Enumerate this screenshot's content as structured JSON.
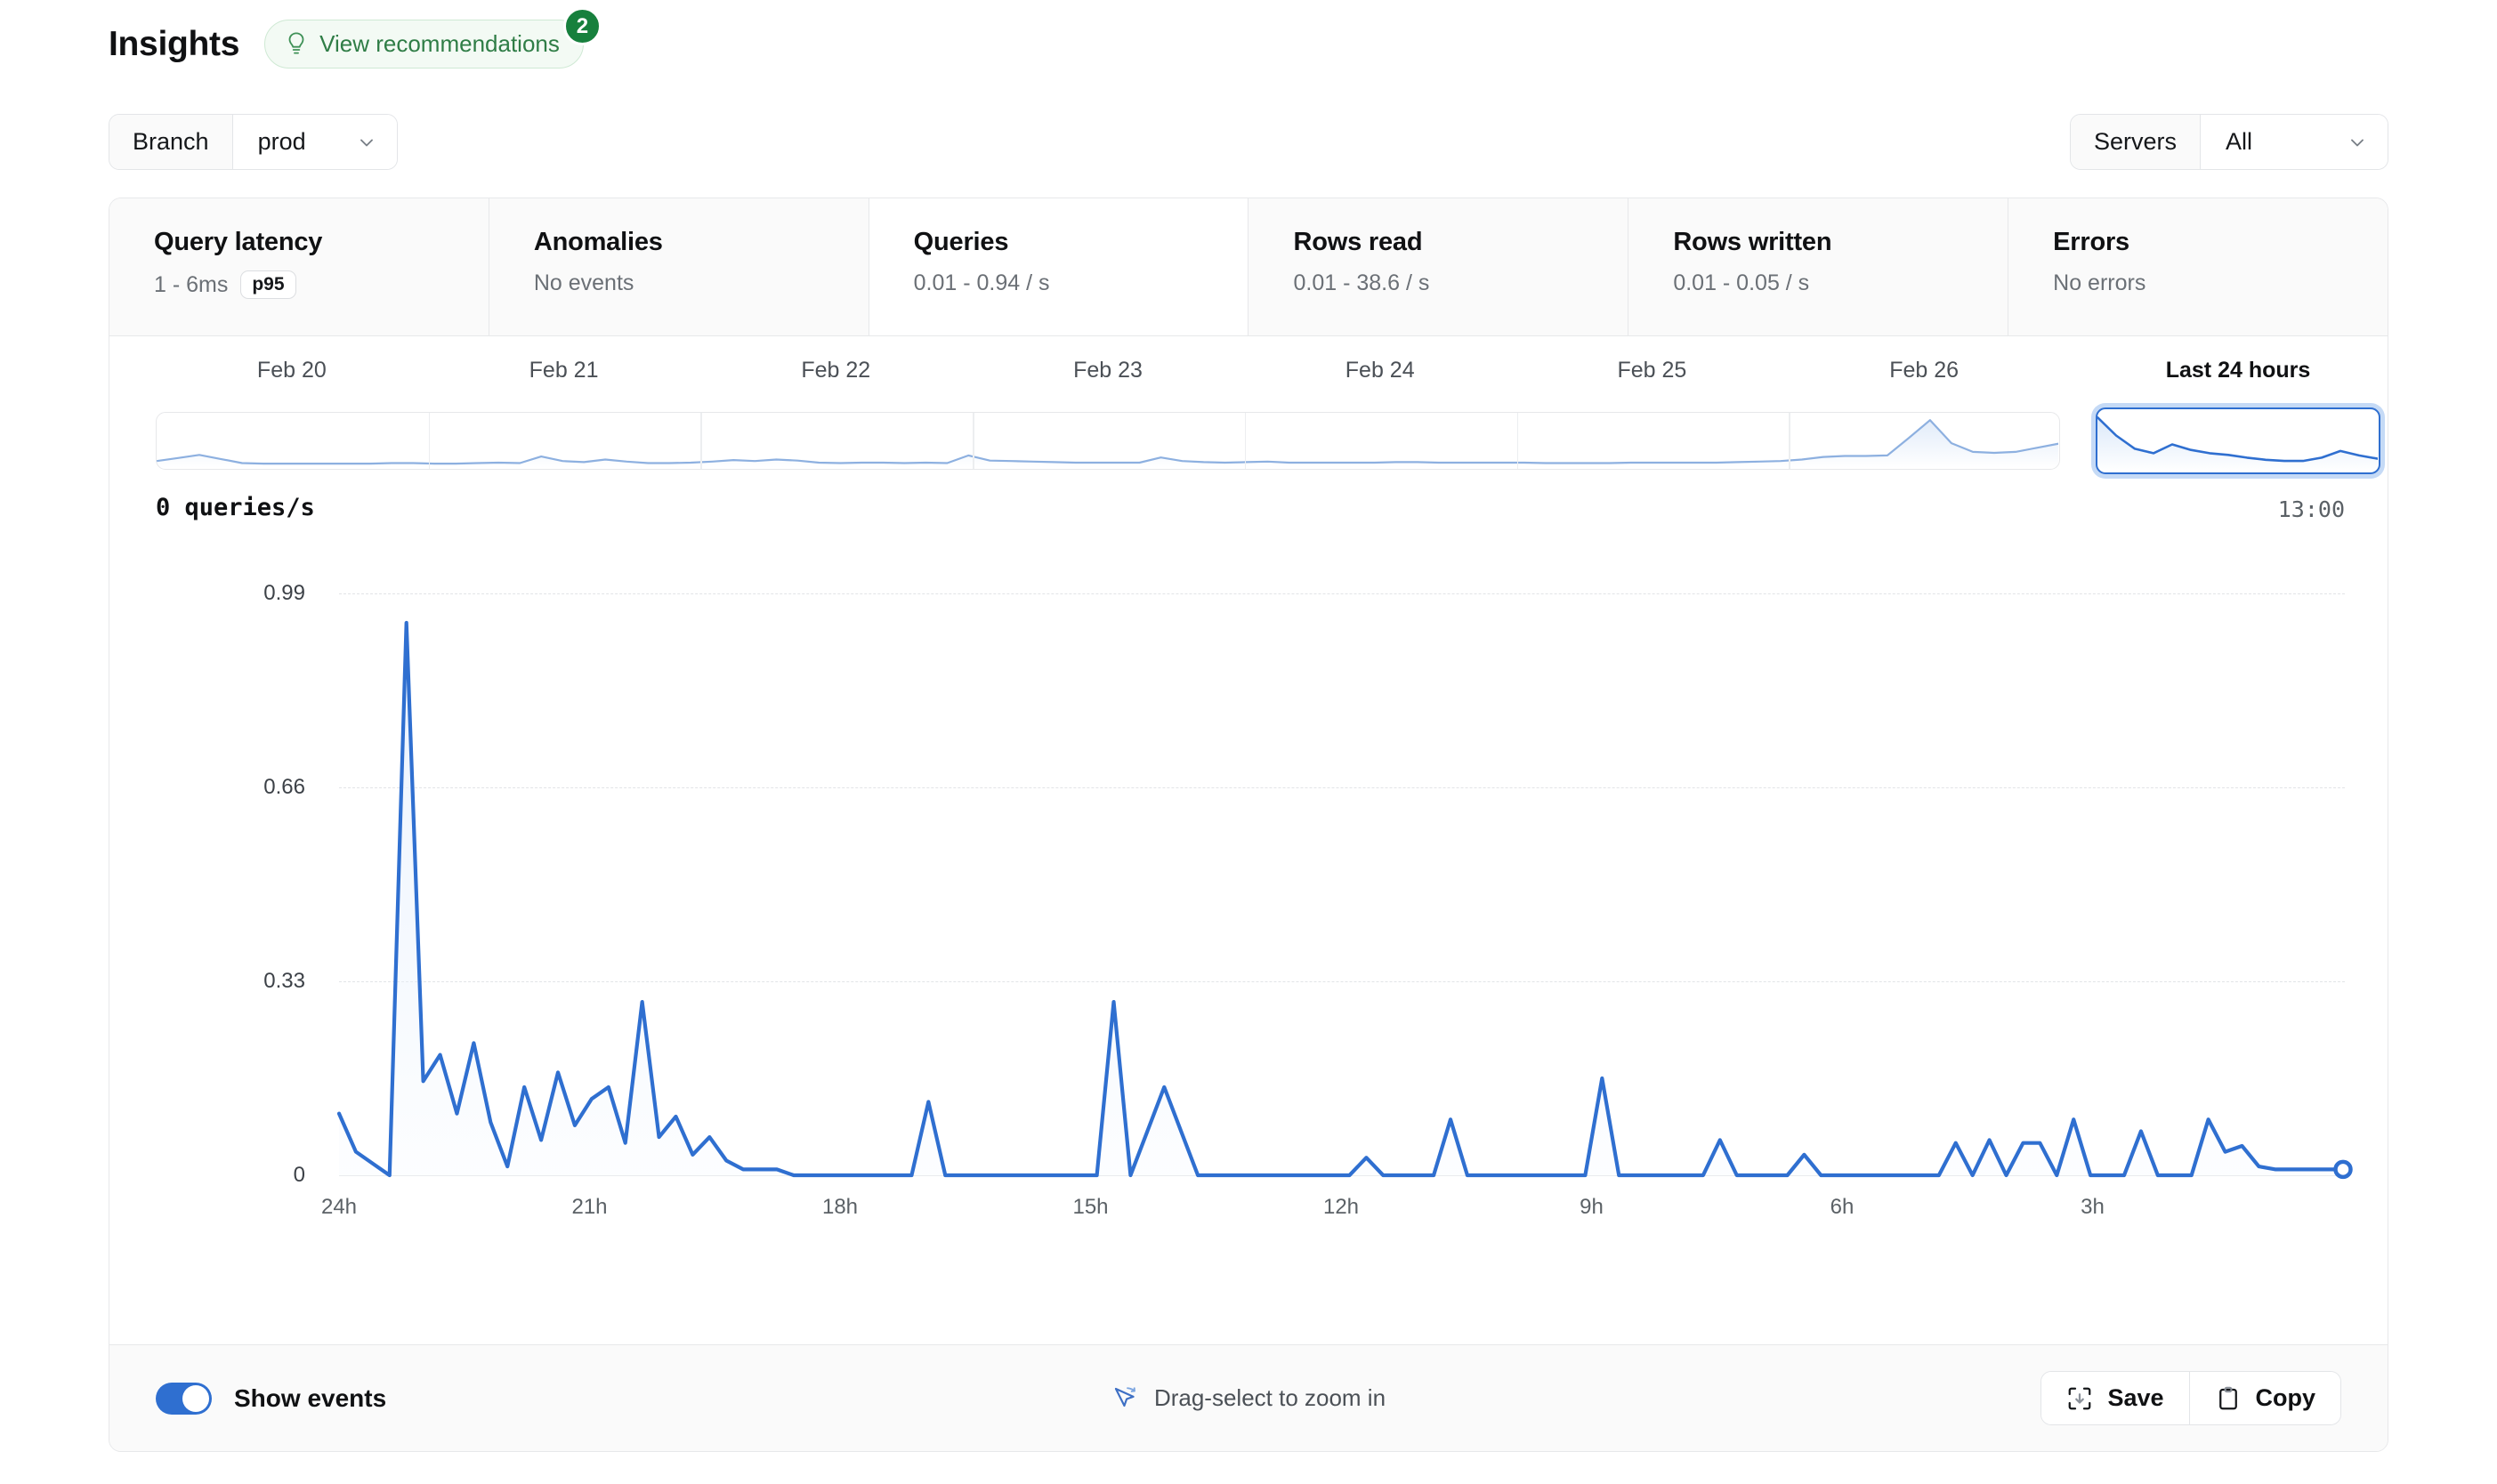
{
  "header": {
    "title": "Insights",
    "recommendations_label": "View recommendations",
    "recommendations_badge": "2",
    "bulb_icon": "lightbulb-icon"
  },
  "filters": {
    "branch": {
      "label": "Branch",
      "value": "prod"
    },
    "servers": {
      "label": "Servers",
      "value": "All"
    }
  },
  "metrics": [
    {
      "title": "Query latency",
      "sub": "1 - 6ms",
      "pill": "p95",
      "active": false
    },
    {
      "title": "Anomalies",
      "sub": "No events",
      "pill": "",
      "active": false
    },
    {
      "title": "Queries",
      "sub": "0.01 - 0.94 / s",
      "pill": "",
      "active": true
    },
    {
      "title": "Rows read",
      "sub": "0.01 - 38.6 / s",
      "pill": "",
      "active": false
    },
    {
      "title": "Rows written",
      "sub": "0.01 - 0.05 / s",
      "pill": "",
      "active": false
    },
    {
      "title": "Errors",
      "sub": "No errors",
      "pill": "",
      "active": false
    }
  ],
  "timeline": {
    "segments": [
      {
        "label": "Feb 20",
        "selected": false
      },
      {
        "label": "Feb 21",
        "selected": false
      },
      {
        "label": "Feb 22",
        "selected": false
      },
      {
        "label": "Feb 23",
        "selected": false
      },
      {
        "label": "Feb 24",
        "selected": false
      },
      {
        "label": "Feb 25",
        "selected": false
      },
      {
        "label": "Feb 26",
        "selected": false
      }
    ],
    "selection": {
      "label": "Last 24 hours",
      "selected": true
    },
    "spark_values": [
      0.1,
      0.16,
      0.22,
      0.14,
      0.06,
      0.05,
      0.05,
      0.05,
      0.05,
      0.05,
      0.05,
      0.06,
      0.06,
      0.05,
      0.05,
      0.06,
      0.07,
      0.06,
      0.19,
      0.1,
      0.08,
      0.13,
      0.09,
      0.06,
      0.06,
      0.07,
      0.09,
      0.12,
      0.1,
      0.13,
      0.11,
      0.07,
      0.06,
      0.07,
      0.07,
      0.06,
      0.07,
      0.06,
      0.21,
      0.11,
      0.1,
      0.09,
      0.08,
      0.07,
      0.07,
      0.07,
      0.07,
      0.17,
      0.1,
      0.08,
      0.07,
      0.08,
      0.09,
      0.07,
      0.07,
      0.07,
      0.07,
      0.07,
      0.08,
      0.08,
      0.07,
      0.07,
      0.07,
      0.07,
      0.07,
      0.06,
      0.06,
      0.06,
      0.06,
      0.07,
      0.07,
      0.07,
      0.07,
      0.07,
      0.08,
      0.09,
      0.1,
      0.13,
      0.18,
      0.2,
      0.2,
      0.21,
      0.55,
      0.9,
      0.45,
      0.28,
      0.26,
      0.28,
      0.36,
      0.44
    ],
    "selection_values": [
      0.95,
      0.62,
      0.38,
      0.3,
      0.46,
      0.36,
      0.3,
      0.27,
      0.22,
      0.18,
      0.16,
      0.16,
      0.22,
      0.34,
      0.26,
      0.2
    ]
  },
  "chart": {
    "value_label": "0 queries/s",
    "time_label": "13:00"
  },
  "chart_data": {
    "type": "area",
    "title": "0 queries/s",
    "xlabel": "",
    "ylabel": "queries/s",
    "ylim": [
      0,
      0.99
    ],
    "yticks": [
      "0.99",
      "0.66",
      "0.33",
      "0"
    ],
    "ytick_values": [
      0.99,
      0.66,
      0.33,
      0
    ],
    "xticks": [
      "24h",
      "21h",
      "18h",
      "15h",
      "12h",
      "9h",
      "6h",
      "3h"
    ],
    "xtick_values": [
      24,
      21,
      18,
      15,
      12,
      9,
      6,
      3
    ],
    "grid": true,
    "legend": "none",
    "line_color": "#2f6fd0",
    "fill_color": "#eaf2fd",
    "end_marker": true,
    "series": [
      {
        "name": "queries/s",
        "values": [
          0.105,
          0.04,
          0.02,
          0.0,
          0.94,
          0.16,
          0.205,
          0.105,
          0.225,
          0.09,
          0.015,
          0.15,
          0.06,
          0.175,
          0.085,
          0.13,
          0.15,
          0.055,
          0.295,
          0.065,
          0.1,
          0.035,
          0.065,
          0.025,
          0.01,
          0.01,
          0.01,
          0.0,
          0.0,
          0.0,
          0.0,
          0.0,
          0.0,
          0.0,
          0.0,
          0.125,
          0.0,
          0.0,
          0.0,
          0.0,
          0.0,
          0.0,
          0.0,
          0.0,
          0.0,
          0.0,
          0.295,
          0.0,
          0.075,
          0.15,
          0.075,
          0.0,
          0.0,
          0.0,
          0.0,
          0.0,
          0.0,
          0.0,
          0.0,
          0.0,
          0.0,
          0.03,
          0.0,
          0.0,
          0.0,
          0.0,
          0.095,
          0.0,
          0.0,
          0.0,
          0.0,
          0.0,
          0.0,
          0.0,
          0.0,
          0.165,
          0.0,
          0.0,
          0.0,
          0.0,
          0.0,
          0.0,
          0.06,
          0.0,
          0.0,
          0.0,
          0.0,
          0.035,
          0.0,
          0.0,
          0.0,
          0.0,
          0.0,
          0.0,
          0.0,
          0.0,
          0.055,
          0.0,
          0.06,
          0.0,
          0.055,
          0.055,
          0.0,
          0.095,
          0.0,
          0.0,
          0.0,
          0.075,
          0.0,
          0.0,
          0.0,
          0.095,
          0.04,
          0.05,
          0.015,
          0.01,
          0.01,
          0.01,
          0.01,
          0.01
        ]
      }
    ]
  },
  "footer": {
    "toggle_label": "Show events",
    "toggle_on": true,
    "hint": "Drag-select to zoom in",
    "hint_icon": "drag-select-cursor-icon",
    "save_label": "Save",
    "save_icon": "save-frame-icon",
    "copy_label": "Copy",
    "copy_icon": "clipboard-icon"
  },
  "colors": {
    "accent": "#2f6fd0",
    "green": "#2f7d46",
    "badge": "#17803d"
  }
}
